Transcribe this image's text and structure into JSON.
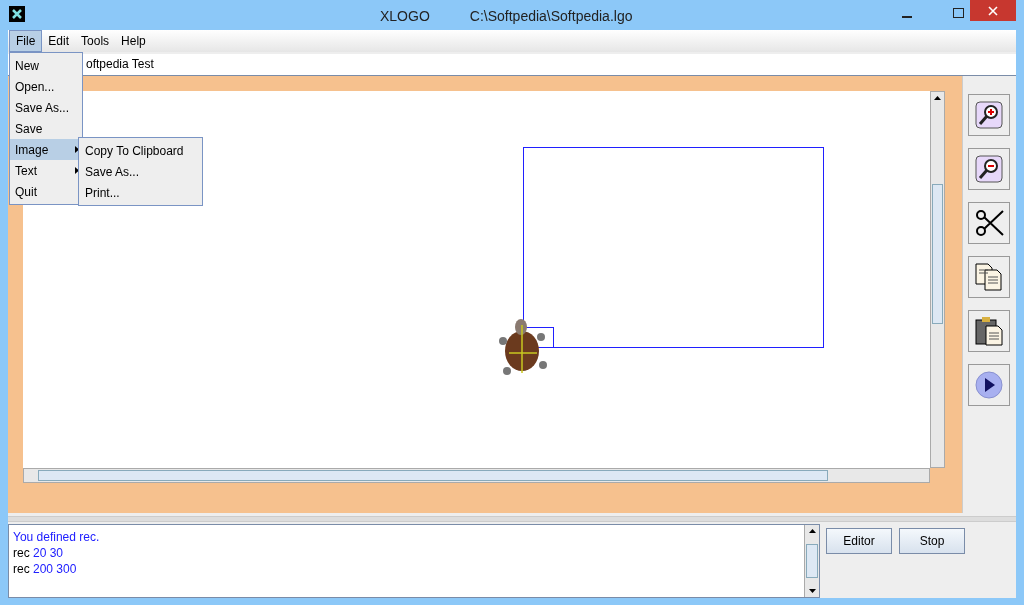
{
  "window": {
    "title": "XLOGO",
    "path": "C:\\Softpedia\\Softpedia.lgo"
  },
  "menu_bar": [
    {
      "label": "File",
      "selected": true
    },
    {
      "label": "Edit",
      "selected": false
    },
    {
      "label": "Tools",
      "selected": false
    },
    {
      "label": "Help",
      "selected": false
    }
  ],
  "file_menu": [
    {
      "label": "New",
      "submenu": false,
      "selected": false
    },
    {
      "label": "Open...",
      "submenu": false,
      "selected": false
    },
    {
      "label": "Save As...",
      "submenu": false,
      "selected": false
    },
    {
      "label": "Save",
      "submenu": false,
      "selected": false
    },
    {
      "label": "Image",
      "submenu": true,
      "selected": true
    },
    {
      "label": "Text",
      "submenu": true,
      "selected": false
    },
    {
      "label": "Quit",
      "submenu": false,
      "selected": false
    }
  ],
  "image_submenu": [
    "Copy To Clipboard",
    "Save As...",
    "Print..."
  ],
  "command_field": {
    "value": "oftpedia Test"
  },
  "history": [
    {
      "kind": "message",
      "text": "You defined rec."
    },
    {
      "kind": "command",
      "text": "rec",
      "args": "20 30"
    },
    {
      "kind": "command",
      "text": "rec",
      "args": "200 300"
    }
  ],
  "buttons": [
    {
      "label": "Editor"
    },
    {
      "label": "Stop"
    }
  ]
}
